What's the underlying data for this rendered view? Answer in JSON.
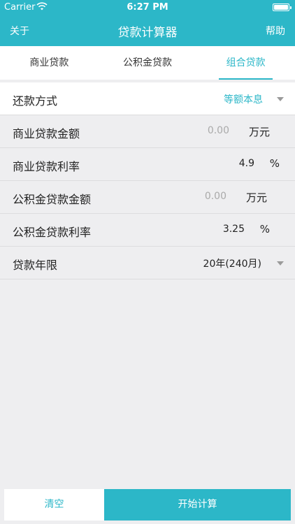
{
  "status_bar": {
    "carrier": "Carrier",
    "time": "6:27 PM"
  },
  "nav": {
    "left": "关于",
    "title": "贷款计算器",
    "right": "帮助"
  },
  "tabs": [
    {
      "label": "商业贷款",
      "active": false
    },
    {
      "label": "公积金贷款",
      "active": false
    },
    {
      "label": "组合贷款",
      "active": true
    }
  ],
  "form": {
    "repay_method": {
      "label": "还款方式",
      "value": "等额本息"
    },
    "commercial_amount": {
      "label": "商业贷款金额",
      "placeholder": "0.00",
      "unit": "万元"
    },
    "commercial_rate": {
      "label": "商业贷款利率",
      "value": "4.9",
      "unit": "%"
    },
    "fund_amount": {
      "label": "公积金贷款金额",
      "placeholder": "0.00",
      "unit": "万元"
    },
    "fund_rate": {
      "label": "公积金贷款利率",
      "value": "3.25",
      "unit": "%"
    },
    "term": {
      "label": "贷款年限",
      "value": "20年(240月)"
    }
  },
  "buttons": {
    "clear": "清空",
    "start": "开始计算"
  },
  "colors": {
    "accent": "#2cb7c8",
    "background": "#eeeef0"
  }
}
